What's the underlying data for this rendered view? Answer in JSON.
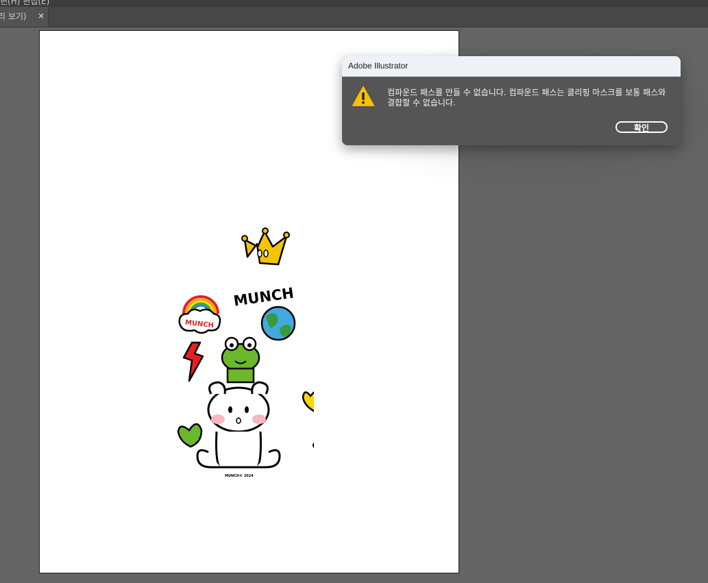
{
  "menubar": {
    "text": "편(H) 편집(E)"
  },
  "tab": {
    "label": "리 보기)",
    "close_glyph": "×"
  },
  "artwork": {
    "munch_text": "MUNCH",
    "cloud_text": "MUNCH",
    "copyright": "MUNCH© 2024"
  },
  "dialog": {
    "title": "Adobe Illustrator",
    "message": "컴파운드 패스를 만들 수 없습니다. 컴파운드 패스는 클리핑 마스크를 보통 패스와 결합할 수 없습니다.",
    "ok_label": "확인"
  },
  "colors": {
    "workspace": "#646464",
    "dialog_body": "#555555",
    "dialog_titlebar": "#eef2f6",
    "warning_yellow": "#f5c000"
  }
}
